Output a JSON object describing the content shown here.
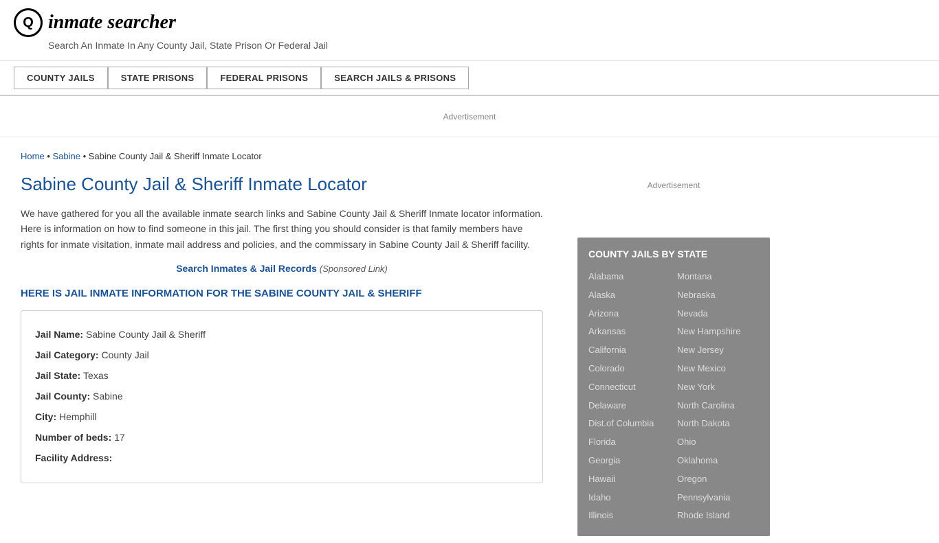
{
  "header": {
    "logo_icon": "🔍",
    "site_name": "inmate searcher",
    "tagline": "Search An Inmate In Any County Jail, State Prison Or Federal Jail"
  },
  "nav": {
    "items": [
      {
        "id": "county-jails",
        "label": "COUNTY JAILS"
      },
      {
        "id": "state-prisons",
        "label": "STATE PRISONS"
      },
      {
        "id": "federal-prisons",
        "label": "FEDERAL PRISONS"
      },
      {
        "id": "search-jails-prisons",
        "label": "SEARCH JAILS & PRISONS"
      }
    ]
  },
  "ad": {
    "banner_label": "Advertisement",
    "sidebar_label": "Advertisement"
  },
  "breadcrumb": {
    "home": "Home",
    "sabine": "Sabine",
    "current": "Sabine County Jail & Sheriff Inmate Locator"
  },
  "page": {
    "title": "Sabine County Jail & Sheriff Inmate Locator",
    "description": "We have gathered for you all the available inmate search links and Sabine County Jail & Sheriff Inmate locator information. Here is information on how to find someone in this jail. The first thing you should consider is that family members have rights for inmate visitation, inmate mail address and policies, and the commissary in Sabine County Jail & Sheriff facility.",
    "sponsored_link_text": "Search Inmates & Jail Records",
    "sponsored_link_suffix": "(Sponsored Link)",
    "jail_section_header": "HERE IS JAIL INMATE INFORMATION FOR THE SABINE COUNTY JAIL & SHERIFF"
  },
  "jail_info": {
    "fields": [
      {
        "label": "Jail Name:",
        "value": "Sabine County Jail & Sheriff"
      },
      {
        "label": "Jail Category:",
        "value": "County Jail"
      },
      {
        "label": "Jail State:",
        "value": "Texas"
      },
      {
        "label": "Jail County:",
        "value": "Sabine"
      },
      {
        "label": "City:",
        "value": "Hemphill"
      },
      {
        "label": "Number of beds:",
        "value": "17"
      },
      {
        "label": "Facility Address:",
        "value": ""
      }
    ]
  },
  "sidebar": {
    "county_jails_title": "COUNTY JAILS BY STATE",
    "states_col1": [
      "Alabama",
      "Alaska",
      "Arizona",
      "Arkansas",
      "California",
      "Colorado",
      "Connecticut",
      "Delaware",
      "Dist.of Columbia",
      "Florida",
      "Georgia",
      "Hawaii",
      "Idaho",
      "Illinois"
    ],
    "states_col2": [
      "Montana",
      "Nebraska",
      "Nevada",
      "New Hampshire",
      "New Jersey",
      "New Mexico",
      "New York",
      "North Carolina",
      "North Dakota",
      "Ohio",
      "Oklahoma",
      "Oregon",
      "Pennsylvania",
      "Rhode Island"
    ]
  }
}
